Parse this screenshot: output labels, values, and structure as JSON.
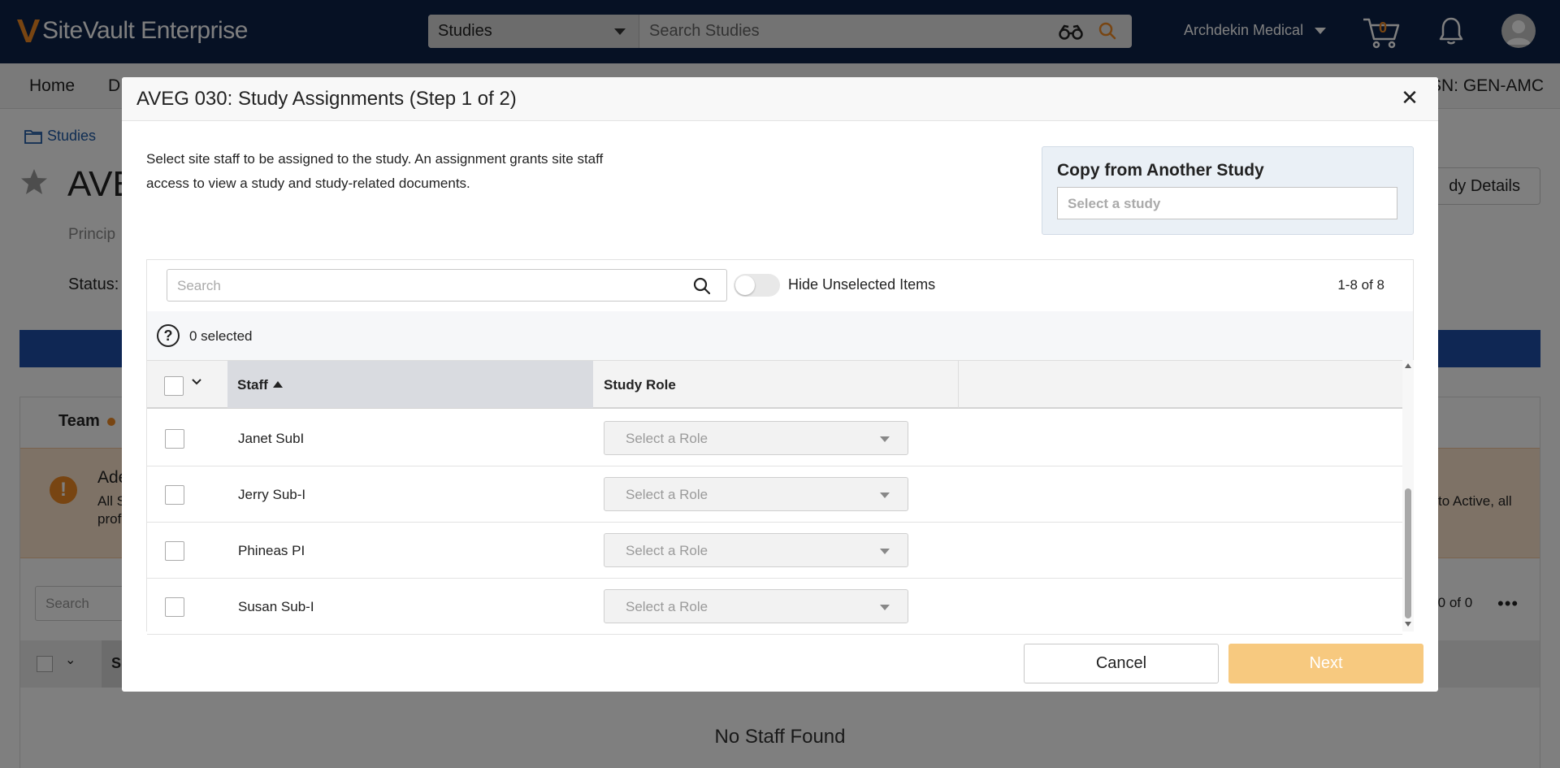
{
  "app": {
    "brand": "SiteVault Enterprise",
    "search_scope": "Studies",
    "search_placeholder": "Search Studies",
    "org_name": "Archdekin Medical",
    "cart_count": "0"
  },
  "background": {
    "nav": {
      "home": "Home",
      "partial": "D",
      "right_text": "SN: GEN-AMC"
    },
    "breadcrumb": "Studies",
    "title": "AVE",
    "principal": "Princip",
    "status": "Status:",
    "details_button": "dy Details",
    "team_tab": "Team",
    "alert": {
      "title": "Ade",
      "line1": "All S",
      "line2": "prof",
      "line_right": "to Active, all"
    },
    "search_placeholder": "Search",
    "count": "-0 of 0",
    "more": "•••",
    "header_partial": "S",
    "empty_message": "No Staff Found"
  },
  "modal": {
    "title": "AVEG 030: Study Assignments (Step 1 of 2)",
    "intro_line1": "Select site staff to be assigned to the study. An assignment grants site staff",
    "intro_line2": "access to view a study and study-related documents.",
    "copy_title": "Copy from Another Study",
    "copy_placeholder": "Select a study",
    "grid": {
      "search_placeholder": "Search",
      "toggle_label": "Hide Unselected Items",
      "range": "1-8 of 8",
      "selected_count": "0 selected",
      "columns": {
        "staff": "Staff",
        "role": "Study Role"
      },
      "rows": [
        {
          "name": "Janet SubI",
          "role_placeholder": "Select a Role"
        },
        {
          "name": "Jerry Sub-I",
          "role_placeholder": "Select a Role"
        },
        {
          "name": "Phineas PI",
          "role_placeholder": "Select a Role"
        },
        {
          "name": "Susan Sub-I",
          "role_placeholder": "Select a Role"
        }
      ]
    },
    "cancel_label": "Cancel",
    "next_label": "Next"
  },
  "colors": {
    "topbar": "#0d2248",
    "accent_orange": "#f08a24",
    "next_disabled": "#f7c97f",
    "link_blue": "#1f5aa6"
  }
}
